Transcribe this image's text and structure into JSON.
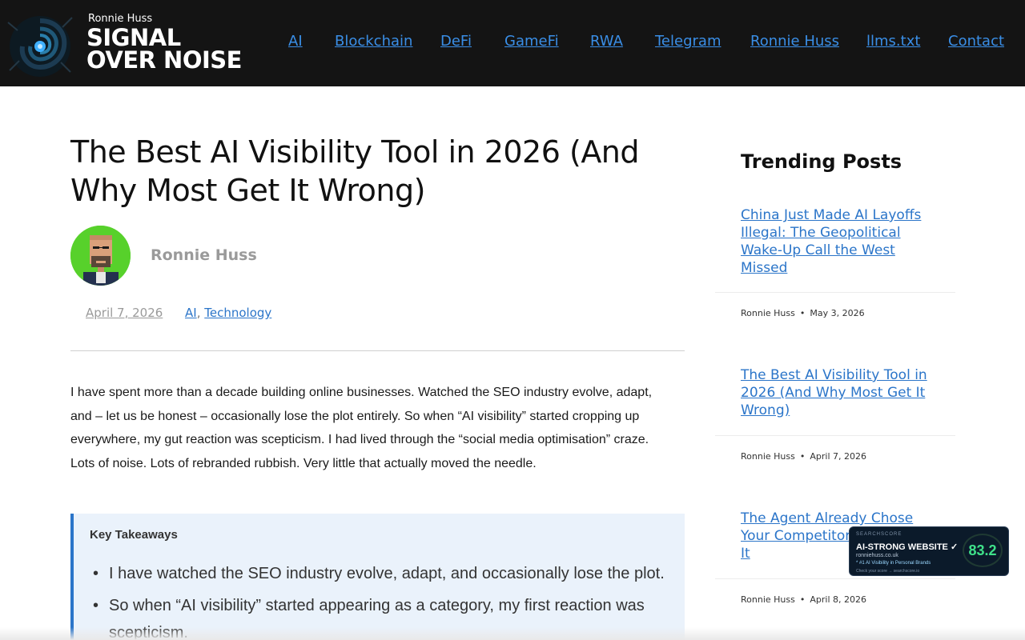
{
  "header": {
    "brand_small": "Ronnie Huss",
    "brand_line1": "SIGNAL",
    "brand_line2": "OVER NOISE",
    "nav": [
      "AI",
      "Blockchain",
      "DeFi",
      "GameFi",
      "RWA",
      "Telegram",
      "Ronnie Huss",
      "llms.txt",
      "Contact"
    ]
  },
  "article": {
    "title": "The Best AI Visibility Tool in 2026 (And Why Most Get It Wrong)",
    "author": "Ronnie Huss",
    "date": "April 7, 2026",
    "categories": [
      "AI",
      "Technology"
    ],
    "category_separator": ",",
    "intro": "I have spent more than a decade building online businesses. Watched the SEO industry evolve, adapt, and – let us be honest – occasionally lose the plot entirely. So when “AI visibility” started cropping up everywhere, my gut reaction was scepticism. I had lived through the “social media optimisation” craze. Lots of noise. Lots of rebranded rubbish. Very little that actually moved the needle.",
    "takeaways": {
      "heading": "Key Takeaways",
      "items": [
        "I have watched the SEO industry evolve, adapt, and occasionally lose the plot.",
        "So when “AI visibility” started appearing as a category, my first reaction was scepticism."
      ]
    }
  },
  "sidebar": {
    "title": "Trending Posts",
    "posts": [
      {
        "title": "China Just Made AI Layoffs Illegal: The Geopolitical Wake-Up Call the West Missed",
        "author": "Ronnie Huss",
        "date": "May 3, 2026"
      },
      {
        "title": "The Best AI Visibility Tool in 2026 (And Why Most Get It Wrong)",
        "author": "Ronnie Huss",
        "date": "April 7, 2026"
      },
      {
        "title": "The Agent Already Chose Your Competitor Didnt See It",
        "author": "Ronnie Huss",
        "date": "April 8, 2026"
      }
    ],
    "meta_dot": "•"
  },
  "badge": {
    "brand": "SEARCHSCORE",
    "headline": "AI-STRONG WEBSITE ✓",
    "domain": "ronniehuss.co.uk",
    "rank": "* #1 AI Visibility in Personal Brands",
    "check": "Check your score → searchscore.io",
    "score": "83.2"
  },
  "colors": {
    "header_bg": "#141414",
    "link": "#2b75c9",
    "nav_link": "#3a8ee6",
    "avatar_bg": "#57d12b",
    "takeaways_bg": "#eaf2fb",
    "score": "#3fe08a"
  },
  "icons": {
    "logo": "signal-swirl-icon",
    "avatar": "pixel-portrait-icon"
  }
}
